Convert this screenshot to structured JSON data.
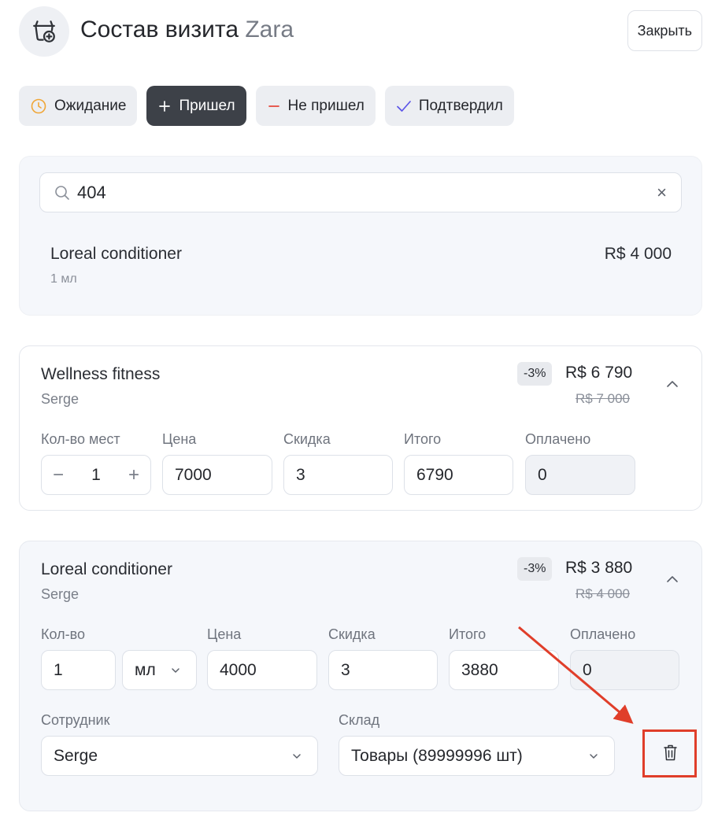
{
  "header": {
    "title": "Состав визита",
    "client": "Zara",
    "close_label": "Закрыть"
  },
  "statuses": [
    {
      "label": "Ожидание",
      "icon": "clock-icon",
      "color": "#f0a637",
      "active": false
    },
    {
      "label": "Пришел",
      "icon": "plus-icon",
      "color": "#ffffff",
      "active": true
    },
    {
      "label": "Не пришел",
      "icon": "minus-icon",
      "color": "#e5483b",
      "active": false
    },
    {
      "label": "Подтвердил",
      "icon": "check-icon",
      "color": "#5b54e8",
      "active": false
    }
  ],
  "search": {
    "value": "404",
    "clear": "×",
    "result": {
      "name": "Loreal conditioner",
      "unit": "1 мл",
      "price": "R$ 4 000"
    }
  },
  "items": [
    {
      "name": "Wellness fitness",
      "staff": "Serge",
      "discount_badge": "-3%",
      "price": "R$ 6 790",
      "old_price": "R$ 7 000",
      "labels": {
        "qty": "Кол-во мест",
        "price": "Цена",
        "discount": "Скидка",
        "total": "Итого",
        "paid": "Оплачено"
      },
      "values": {
        "qty": "1",
        "qty_minus": "−",
        "qty_plus": "+",
        "price": "7000",
        "discount": "3",
        "total": "6790",
        "paid": "0"
      }
    },
    {
      "name": "Loreal conditioner",
      "staff": "Serge",
      "discount_badge": "-3%",
      "price": "R$ 3 880",
      "old_price": "R$ 4 000",
      "labels": {
        "qty": "Кол-во",
        "price": "Цена",
        "discount": "Скидка",
        "total": "Итого",
        "paid": "Оплачено",
        "employee": "Сотрудник",
        "warehouse": "Склад"
      },
      "values": {
        "qty": "1",
        "unit": "мл",
        "price": "4000",
        "discount": "3",
        "total": "3880",
        "paid": "0",
        "employee": "Serge",
        "warehouse": "Товары (89999996 шт)"
      }
    }
  ],
  "annotation_color": "#e03e2a"
}
